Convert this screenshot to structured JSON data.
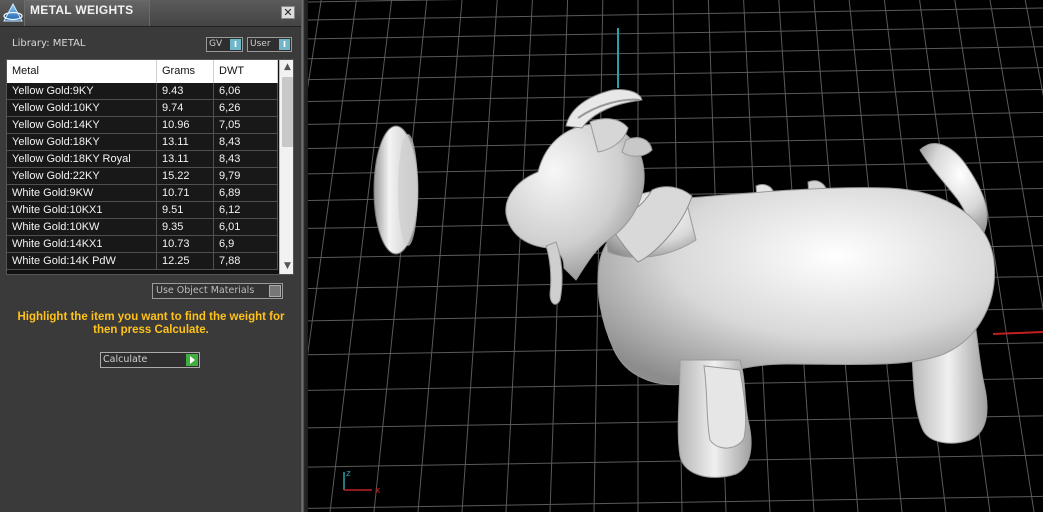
{
  "panel": {
    "title": "METAL WEIGHTS",
    "close_label": "✕",
    "library_label": "Library: METAL",
    "gv_label": "GV",
    "user_label": "User",
    "toggle_glyph": "I"
  },
  "table": {
    "headers": [
      "Metal",
      "Grams",
      "DWT"
    ],
    "rows": [
      {
        "metal": "Yellow Gold:9KY",
        "grams": "9.43",
        "dwt": "6,06"
      },
      {
        "metal": "Yellow Gold:10KY",
        "grams": "9.74",
        "dwt": "6,26"
      },
      {
        "metal": "Yellow Gold:14KY",
        "grams": "10.96",
        "dwt": "7,05"
      },
      {
        "metal": "Yellow Gold:18KY",
        "grams": "13.11",
        "dwt": "8,43"
      },
      {
        "metal": "Yellow Gold:18KY Royal",
        "grams": "13.11",
        "dwt": "8,43"
      },
      {
        "metal": "Yellow Gold:22KY",
        "grams": "15.22",
        "dwt": "9,79"
      },
      {
        "metal": "White Gold:9KW",
        "grams": "10.71",
        "dwt": "6,89"
      },
      {
        "metal": "White Gold:10KX1",
        "grams": "9.51",
        "dwt": "6,12"
      },
      {
        "metal": "White Gold:10KW",
        "grams": "9.35",
        "dwt": "6,01"
      },
      {
        "metal": "White Gold:14KX1",
        "grams": "10.73",
        "dwt": "6,9"
      },
      {
        "metal": "White Gold:14K PdW",
        "grams": "12.25",
        "dwt": "7,88"
      }
    ]
  },
  "controls": {
    "use_object_materials": "Use Object Materials",
    "instruction": "Highlight the item you want to find the weight for then press Calculate.",
    "calculate_label": "Calculate"
  },
  "viewport": {
    "axis_y_label": "z",
    "axis_x_label": "x"
  },
  "colors": {
    "instruction": "#ffc21a",
    "toggle": "#6fb6c8",
    "calculate_play": "#3fae3f",
    "grid": "#6a6a6a"
  }
}
